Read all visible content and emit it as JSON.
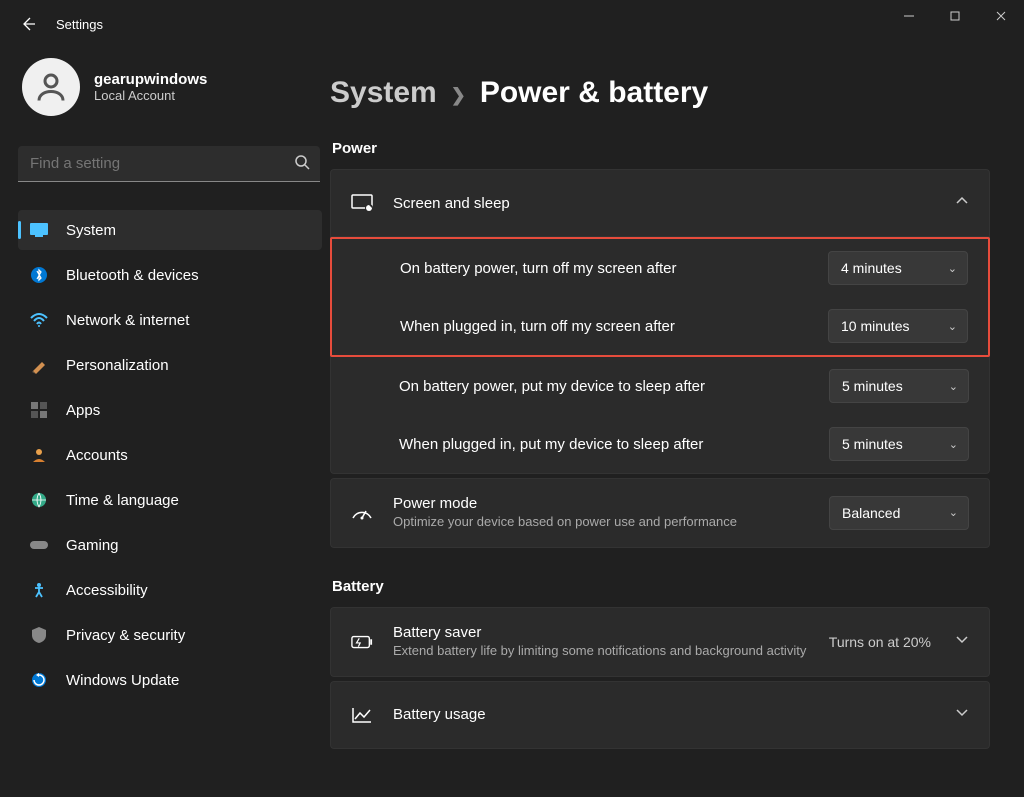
{
  "window": {
    "app_title": "Settings"
  },
  "profile": {
    "name": "gearupwindows",
    "account_type": "Local Account"
  },
  "search": {
    "placeholder": "Find a setting"
  },
  "nav": {
    "items": [
      {
        "label": "System"
      },
      {
        "label": "Bluetooth & devices"
      },
      {
        "label": "Network & internet"
      },
      {
        "label": "Personalization"
      },
      {
        "label": "Apps"
      },
      {
        "label": "Accounts"
      },
      {
        "label": "Time & language"
      },
      {
        "label": "Gaming"
      },
      {
        "label": "Accessibility"
      },
      {
        "label": "Privacy & security"
      },
      {
        "label": "Windows Update"
      }
    ]
  },
  "breadcrumb": {
    "parent": "System",
    "current": "Power & battery"
  },
  "sections": {
    "power": {
      "heading": "Power",
      "screen_sleep": {
        "title": "Screen and sleep",
        "battery_screen_off_label": "On battery power, turn off my screen after",
        "battery_screen_off_value": "4 minutes",
        "plugged_screen_off_label": "When plugged in, turn off my screen after",
        "plugged_screen_off_value": "10 minutes",
        "battery_sleep_label": "On battery power, put my device to sleep after",
        "battery_sleep_value": "5 minutes",
        "plugged_sleep_label": "When plugged in, put my device to sleep after",
        "plugged_sleep_value": "5 minutes"
      },
      "power_mode": {
        "title": "Power mode",
        "subtitle": "Optimize your device based on power use and performance",
        "value": "Balanced"
      }
    },
    "battery": {
      "heading": "Battery",
      "saver": {
        "title": "Battery saver",
        "subtitle": "Extend battery life by limiting some notifications and background activity",
        "status": "Turns on at 20%"
      },
      "usage": {
        "title": "Battery usage"
      }
    }
  }
}
